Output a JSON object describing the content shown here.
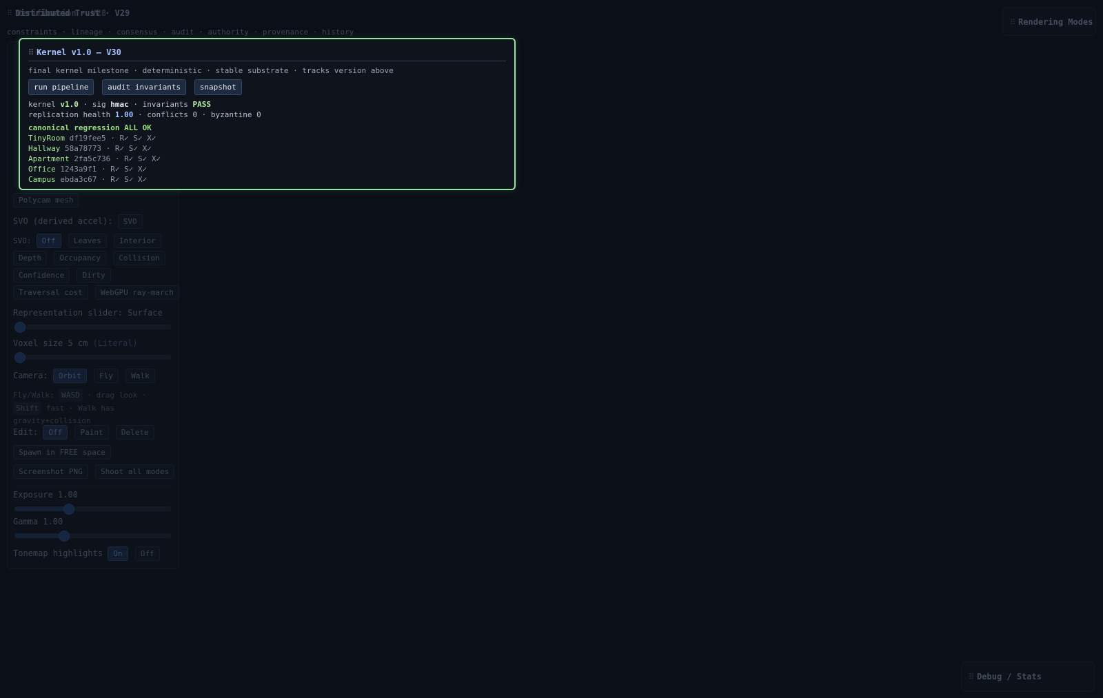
{
  "background": {
    "stacked_titles": [
      "Distributed Trust · V29",
      "Verification · V28",
      "Rendering Modes"
    ],
    "stacked_subtitle": "constraints · lineage · consensus · audit · authority · provenance · history",
    "left_panel": {
      "polycam_chip": "Polycam mesh",
      "svo_derived_label": "SVO (derived accel):",
      "svo_derived_chip": "SVO",
      "svo_label": "SVO:",
      "svo_modes_row1": [
        "Off",
        "Leaves",
        "Interior"
      ],
      "svo_modes_row2": [
        "Depth",
        "Occupancy",
        "Collision"
      ],
      "svo_modes_row3": [
        "Confidence",
        "Dirty"
      ],
      "svo_modes_row4": [
        "Traversal cost",
        "WebGPU ray-march"
      ],
      "repr_slider_label": "Representation slider: Surface",
      "representation_level": 0,
      "voxel_label": "Voxel size 5 cm",
      "voxel_note": "(Literal)",
      "voxel_level": 0,
      "camera_label": "Camera:",
      "camera_modes": [
        "Orbit",
        "Fly",
        "Walk"
      ],
      "flywalk_prefix": "Fly/Walk:",
      "flywalk_key1": "WASD",
      "flywalk_mid": "· drag look ·",
      "flywalk_key2": "Shift",
      "flywalk_suffix": "fast · Walk has gravity+collision",
      "edit_label": "Edit:",
      "edit_modes": [
        "Off",
        "Paint",
        "Delete"
      ],
      "spawn_button": "Spawn in FREE space",
      "screenshot_button": "Screenshot PNG",
      "shoot_all_button": "Shoot all modes",
      "exposure_label": "Exposure 1.00",
      "exposure_level": 0.33,
      "gamma_label": "Gamma 1.00",
      "gamma_level": 0.3,
      "tonemap_label": "Tonemap highlights",
      "tonemap_on": "On",
      "tonemap_off": "Off"
    },
    "rendering_modes_title": "Rendering Modes",
    "debug_stats_title": "Debug / Stats"
  },
  "kernel": {
    "title": "Kernel v1.0 — V30",
    "description": "final kernel milestone · deterministic · stable substrate · tracks version above",
    "buttons": [
      "run pipeline",
      "audit invariants",
      "snapshot"
    ],
    "status": {
      "kernel_label": "kernel",
      "kernel_version": "v1.0",
      "sig_label": "· sig",
      "sig_value": "hmac",
      "invariants_label": "· invariants",
      "invariants_value": "PASS"
    },
    "replication": {
      "label": "replication health",
      "health": "1.00",
      "rest": "· conflicts 0 · byzantine 0"
    },
    "regression_title": "canonical regression ALL OK",
    "scenes": [
      {
        "name": "TinyRoom",
        "detail": "df19fee5 · R✓ S✓ X✓"
      },
      {
        "name": "Hallway",
        "detail": "58a78773 · R✓ S✓ X✓"
      },
      {
        "name": "Apartment",
        "detail": "2fa5c736 · R✓ S✓ X✓"
      },
      {
        "name": "Office",
        "detail": "1243a9f1 · R✓ S✓ X✓"
      },
      {
        "name": "Campus",
        "detail": "ebda3c67 · R✓ S✓ X✓"
      }
    ]
  }
}
